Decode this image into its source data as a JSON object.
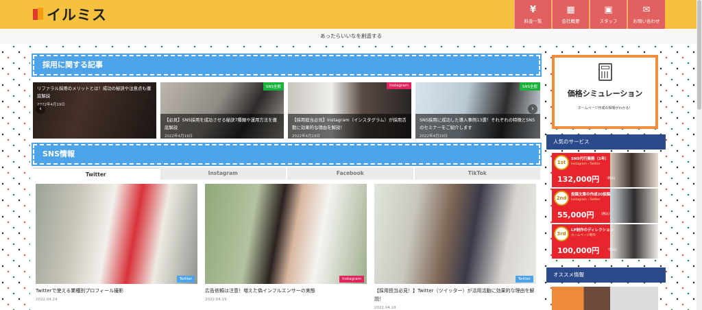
{
  "header": {
    "logo_text": "イルミス",
    "nav": [
      {
        "label": "料金一覧",
        "icon": "yen-icon",
        "glyph": "¥"
      },
      {
        "label": "会社概要",
        "icon": "building-icon",
        "glyph": "▦"
      },
      {
        "label": "スタッフ",
        "icon": "id-card-icon",
        "glyph": "▣"
      },
      {
        "label": "お問い合わせ",
        "icon": "mail-icon",
        "glyph": "✉"
      }
    ],
    "tagline": "あったらいいなを創造する"
  },
  "recruit_section": {
    "title": "採用に関する記事",
    "slides": [
      {
        "title": "リファラル採用のメリットとは！成功の秘訣や注意点も徹底解説",
        "date": "2022年4月19日",
        "tag": ""
      },
      {
        "title": "【必見】SNS採用を成功させる秘訣7種類や運用方法を徹底解説",
        "date": "2022年4月19日",
        "tag": "SNS全般"
      },
      {
        "title": "【採用担当必見】Instagram（インスタグラム）が採用活動に効果的な理由を解説！",
        "date": "2022年4月19日",
        "tag": "Instagram"
      },
      {
        "title": "SNS採用に成功した導入事例13選！それぞれの特徴とSNSのセミナーをご紹介します",
        "date": "2022年4月19日",
        "tag": "SNS全般"
      }
    ],
    "prev_glyph": "‹",
    "next_glyph": "›"
  },
  "sns_section": {
    "title": "SNS情報",
    "tabs": [
      "Twitter",
      "Instagram",
      "Facebook",
      "TikTok"
    ],
    "active_tab": "Twitter",
    "cards": [
      {
        "title": "Twitterで使える業種別プロフィール撮影",
        "date": "2022.04.24",
        "tag": "Twitter"
      },
      {
        "title": "広告依頼は注意！増えた偽インフルエンサーの実態",
        "date": "2022.04.19",
        "tag": "Instagram"
      },
      {
        "title": "【採用担当必見！】Twitter（ツイッター）が活用活動に効果的な理由を解説！",
        "date": "2022.04.18",
        "tag": "Twitter"
      }
    ]
  },
  "sidebar": {
    "sim": {
      "title": "価格シミュレーション",
      "subtitle": "ホームページ作成の相場がわかる！"
    },
    "popular_title": "人気のサービス",
    "services": [
      {
        "rank": "1st",
        "name": "SNS代行業務（1年）",
        "sub": "Instagram・Twitter",
        "price": "132,000円",
        "tax": "(税込)",
        "color": "#e8242c"
      },
      {
        "rank": "2nd",
        "name": "投稿文章の作成20投稿",
        "sub": "Instagram・Twitter",
        "price": "55,000円",
        "tax": "(税込)",
        "color": "#e8242c"
      },
      {
        "rank": "3rd",
        "name": "LP制作のディレクション",
        "sub": "ホームページ制作",
        "price": "100,000円",
        "tax": "(税込)",
        "color": "#e8242c"
      }
    ],
    "osusume_title": "オススメ情報"
  },
  "colors": {
    "header_bg": "#f7c140",
    "nav_bg": "#e2605f",
    "section_blue": "#4da3e8",
    "sidebar_head": "#2a4a8b",
    "tag_sns": "#19b33b",
    "tag_instagram": "#e0245e",
    "tag_twitter": "#4da3e8"
  }
}
